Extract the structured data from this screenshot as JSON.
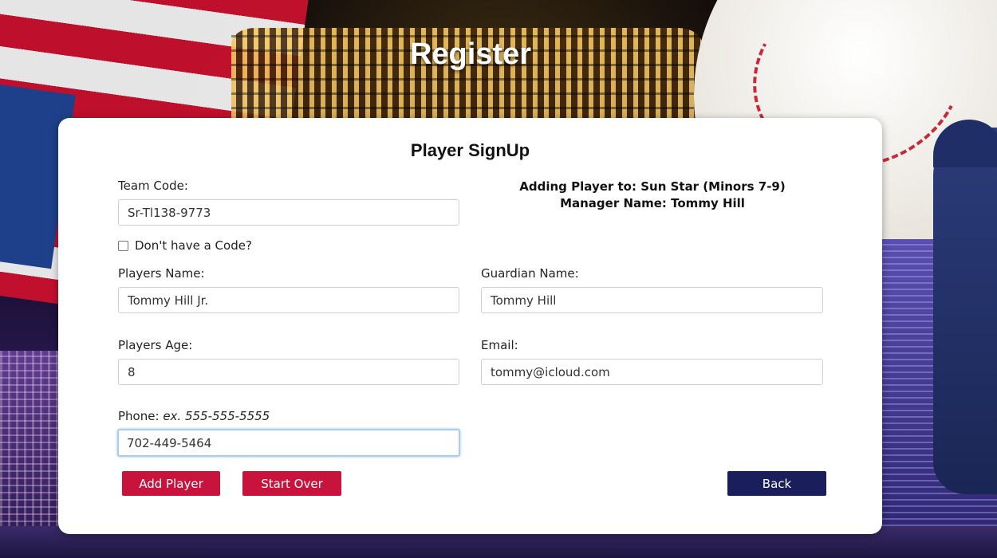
{
  "page": {
    "title": "Register"
  },
  "form": {
    "title": "Player SignUp",
    "team_code": {
      "label": "Team Code:",
      "value": "Sr-Tl138-9773"
    },
    "no_code_checkbox": {
      "label": "Don't have a Code?",
      "checked": false
    },
    "team_info": {
      "adding_to": "Adding Player to: Sun Star (Minors 7-9)",
      "manager": "Manager Name: Tommy Hill"
    },
    "players_name": {
      "label": "Players Name:",
      "value": "Tommy Hill Jr."
    },
    "guardian_name": {
      "label": "Guardian Name:",
      "value": "Tommy Hill"
    },
    "players_age": {
      "label": "Players Age:",
      "value": "8"
    },
    "email": {
      "label": "Email:",
      "value": "tommy@icloud.com"
    },
    "phone": {
      "label": "Phone:",
      "hint": "ex. 555-555-5555",
      "value": "702-449-5464"
    },
    "buttons": {
      "add_player": "Add Player",
      "start_over": "Start Over",
      "back": "Back"
    }
  },
  "colors": {
    "primary_button": "#c8143c",
    "back_button": "#1a1f5c",
    "focus_ring": "#a9cdf0"
  }
}
